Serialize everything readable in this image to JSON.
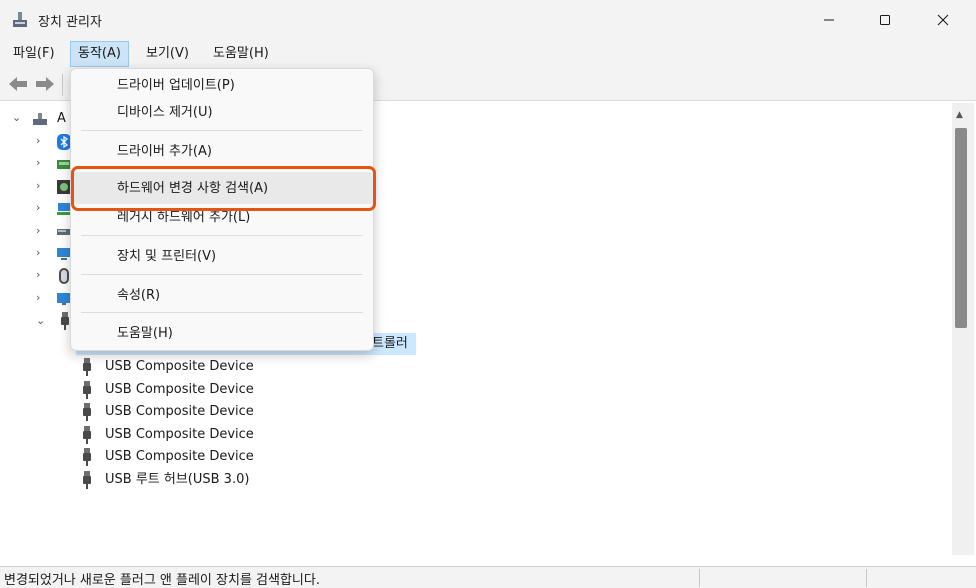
{
  "window": {
    "title": "장치 관리자",
    "icons": {
      "app": "device-manager-icon",
      "minimize": "minimize-icon",
      "maximize": "maximize-icon",
      "close": "close-icon"
    }
  },
  "menubar": {
    "items": [
      {
        "label": "파일(F)",
        "active": false
      },
      {
        "label": "동작(A)",
        "active": true
      },
      {
        "label": "보기(V)",
        "active": false
      },
      {
        "label": "도움말(H)",
        "active": false
      }
    ]
  },
  "toolbar": {
    "icons": [
      "back-arrow-icon",
      "forward-arrow-icon"
    ]
  },
  "tree": {
    "root_label_partial": "A",
    "partial_controller_label": "트롤러",
    "usb_devices": [
      "USB Composite Device",
      "USB Composite Device",
      "USB Composite Device",
      "USB Composite Device",
      "USB Composite Device",
      "USB 루트 허브(USB 3.0)"
    ]
  },
  "action_menu": {
    "items": [
      "드라이버 업데이트(P)",
      "디바이스 제거(U)",
      "드라이버 추가(A)",
      "하드웨어 변경 사항 검색(A)",
      "레거시 하드웨어 추가(L)",
      "장치 및 프린터(V)",
      "속성(R)",
      "도움말(H)"
    ],
    "highlighted_index": 3,
    "highlight_color": "#e6550f"
  },
  "statusbar": {
    "text": "변경되었거나 새로운 플러그 앤 플레이 장치를 검색합니다."
  }
}
